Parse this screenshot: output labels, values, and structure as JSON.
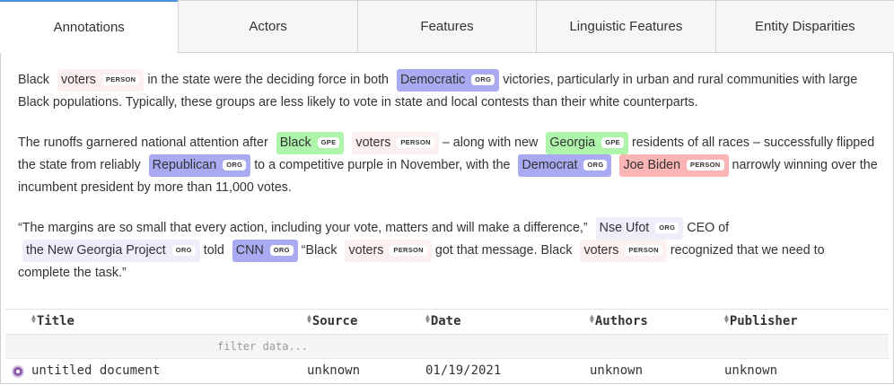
{
  "tabs": [
    {
      "label": "Annotations",
      "active": true
    },
    {
      "label": "Actors"
    },
    {
      "label": "Features"
    },
    {
      "label": "Linguistic Features"
    },
    {
      "label": "Entity Disparities"
    }
  ],
  "paragraphs": {
    "p1": {
      "t1": "Black",
      "e1": {
        "text": "voters",
        "label": "PERSON"
      },
      "t2": "in the state were the deciding force in both",
      "e2": {
        "text": "Democratic",
        "label": "ORG"
      },
      "t3": "victories, particularly in urban and rural communities with large Black populations. Typically, these groups are less likely to vote in state and local contests than their white counterparts."
    },
    "p2": {
      "t1": "The runoffs garnered national attention after",
      "e1": {
        "text": "Black",
        "label": "GPE"
      },
      "e2": {
        "text": "voters",
        "label": "PERSON"
      },
      "t2": "– along with new",
      "e3": {
        "text": "Georgia",
        "label": "GPE"
      },
      "t3": "residents of all races – successfully flipped the state from reliably",
      "e4": {
        "text": "Republican",
        "label": "ORG"
      },
      "t4": "to a competitive purple in November, with the",
      "e5": {
        "text": "Democrat",
        "label": "ORG"
      },
      "e6": {
        "text": "Joe Biden",
        "label": "PERSON"
      },
      "t5": "narrowly winning over the incumbent president by more than 11,000 votes."
    },
    "p3": {
      "t1": "“The margins are so small that every action, including your vote, matters and will make a difference,”",
      "e1": {
        "text": "Nse Ufot",
        "label": "ORG"
      },
      "t2": "CEO of",
      "e2": {
        "text": "the New Georgia Project",
        "label": "ORG"
      },
      "t3": "told",
      "e3": {
        "text": "CNN",
        "label": "ORG"
      },
      "t4": "“Black",
      "e4": {
        "text": "voters",
        "label": "PERSON"
      },
      "t5": "got that message. Black",
      "e5": {
        "text": "voters",
        "label": "PERSON"
      },
      "t6": "recognized that we need to complete the task.”"
    }
  },
  "colors": {
    "person": "#fdf0f0",
    "person_strong": "#fbb5b5",
    "org": "#aaaaf2",
    "org_light": "#eeeefb",
    "gpe": "#aef4ab",
    "doc_icon": "#8b5aa8"
  },
  "table": {
    "columns": [
      "Title",
      "Source",
      "Date",
      "Authors",
      "Publisher"
    ],
    "filter_placeholder": "filter data...",
    "rows": [
      {
        "icon": "document-dot-icon",
        "title": "untitled document",
        "source": "unknown",
        "date": "01/19/2021",
        "authors": "unknown",
        "publisher": "unknown"
      }
    ]
  }
}
